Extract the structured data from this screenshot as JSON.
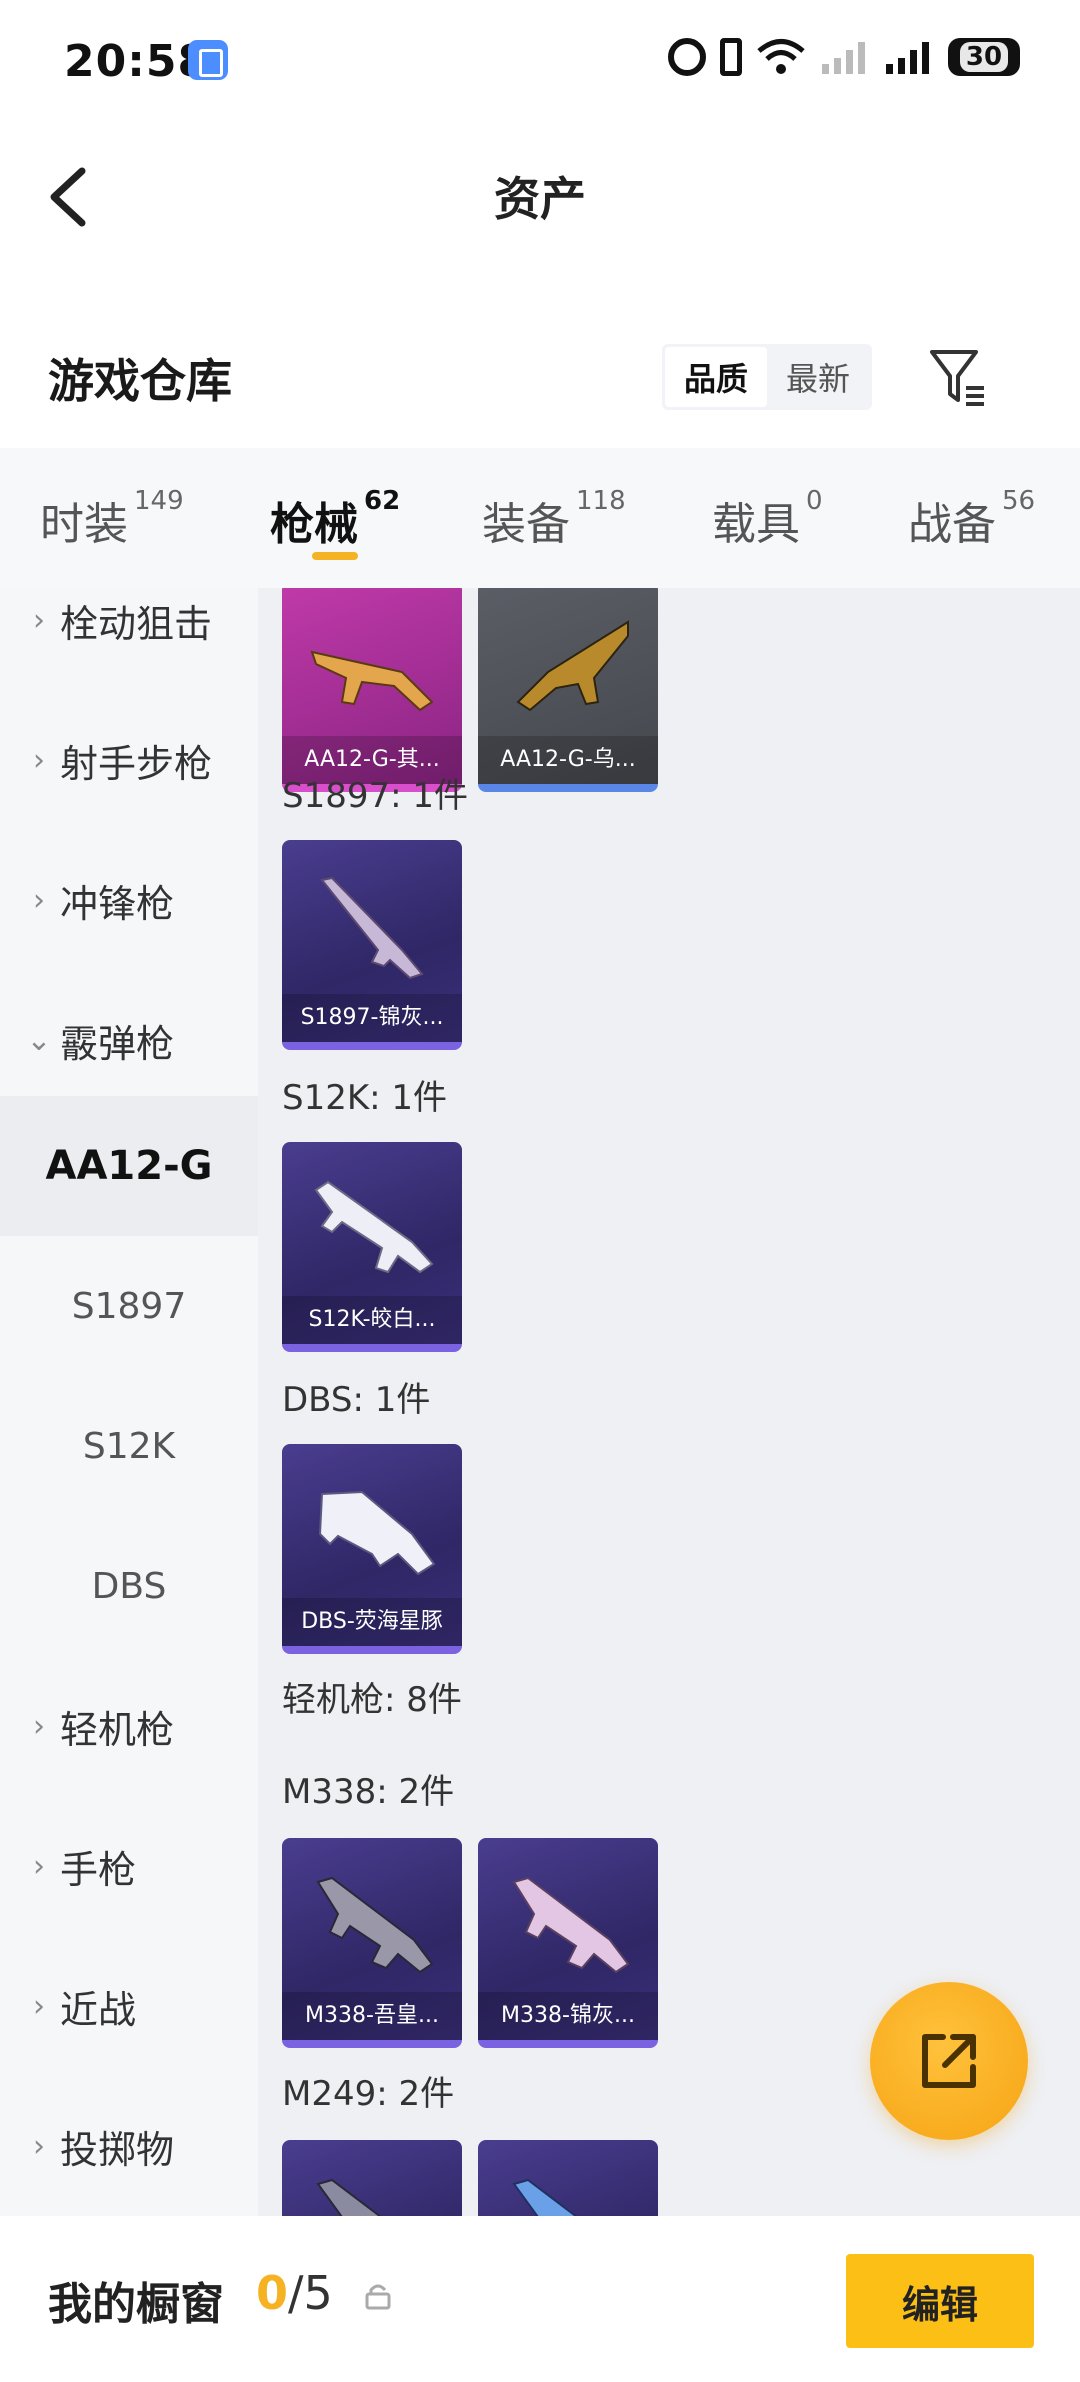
{
  "status_bar": {
    "time": "20:58",
    "battery": "30"
  },
  "header": {
    "title": "资产"
  },
  "warehouse": {
    "title": "游戏仓库",
    "sort_options": [
      {
        "label": "品质",
        "active": true
      },
      {
        "label": "最新",
        "active": false
      }
    ]
  },
  "tabs": [
    {
      "label": "时装",
      "count": "149",
      "active": false
    },
    {
      "label": "枪械",
      "count": "62",
      "active": true
    },
    {
      "label": "装备",
      "count": "118",
      "active": false
    },
    {
      "label": "载具",
      "count": "0",
      "active": false
    },
    {
      "label": "战备",
      "count": "56",
      "active": false
    }
  ],
  "sidebar": {
    "items": [
      {
        "label": "栓动狙击",
        "type": "category"
      },
      {
        "label": "射手步枪",
        "type": "category"
      },
      {
        "label": "冲锋枪",
        "type": "category"
      },
      {
        "label": "霰弹枪",
        "type": "category-open"
      },
      {
        "label": "AA12-G",
        "type": "sub-active"
      },
      {
        "label": "S1897",
        "type": "sub"
      },
      {
        "label": "S12K",
        "type": "sub"
      },
      {
        "label": "DBS",
        "type": "sub"
      },
      {
        "label": "轻机枪",
        "type": "category"
      },
      {
        "label": "手枪",
        "type": "category"
      },
      {
        "label": "近战",
        "type": "category"
      },
      {
        "label": "投掷物",
        "type": "category"
      }
    ]
  },
  "content": {
    "groups": [
      {
        "label": "",
        "items": [
          {
            "name": "AA12-G-其...",
            "rarity": "pink"
          },
          {
            "name": "AA12-G-乌...",
            "rarity": "gray"
          }
        ]
      },
      {
        "label": "S1897: 1件",
        "items": [
          {
            "name": "S1897-锦灰...",
            "rarity": "purple"
          }
        ]
      },
      {
        "label": "S12K: 1件",
        "items": [
          {
            "name": "S12K-皎白...",
            "rarity": "purple"
          }
        ]
      },
      {
        "label": "DBS: 1件",
        "items": [
          {
            "name": "DBS-荧海星豚",
            "rarity": "purple"
          }
        ]
      },
      {
        "label": "轻机枪: 8件",
        "items": []
      },
      {
        "label": "M338: 2件",
        "items": [
          {
            "name": "M338-吾皇...",
            "rarity": "purple"
          },
          {
            "name": "M338-锦灰...",
            "rarity": "purple"
          }
        ]
      },
      {
        "label": "M249: 2件",
        "items": [
          {
            "name": "",
            "rarity": "purple"
          },
          {
            "name": "",
            "rarity": "purple"
          }
        ]
      }
    ]
  },
  "bottom_bar": {
    "title": "我的橱窗",
    "current": "0",
    "total": "/5",
    "edit_label": "编辑"
  },
  "colors": {
    "accent": "#f5b324",
    "button": "#fbbf16",
    "epic": "#7b62e0",
    "legendary": "#d94ecb",
    "rare": "#5a86e8"
  }
}
